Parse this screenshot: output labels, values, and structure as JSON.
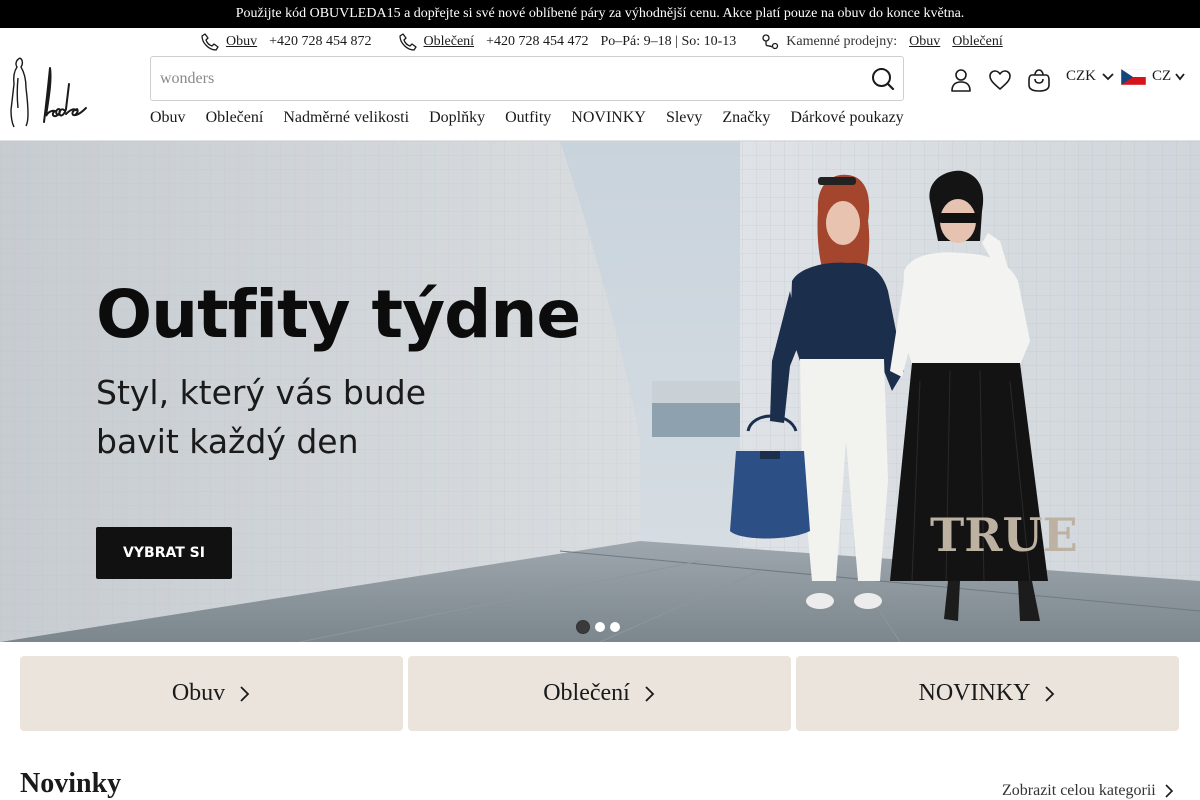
{
  "promo": {
    "text": "Použijte kód OBUVLEDA15 a dopřejte si své nové oblíbené páry za výhodnější cenu. Akce platí pouze na obuv do konce května."
  },
  "contact": {
    "shoes_link": "Obuv",
    "shoes_phone": "+420 728 454 872",
    "clothing_link": "Oblečení",
    "clothing_phone": "+420 728 454 472",
    "hours": "Po–Pá: 9–18 | So: 10-13",
    "stores_label": "Kamenné prodejny:",
    "stores_shoes": "Obuv",
    "stores_clothing": "Oblečení"
  },
  "search": {
    "placeholder": "wonders"
  },
  "header": {
    "currency": "CZK",
    "language": "CZ"
  },
  "nav": {
    "items": [
      "Obuv",
      "Oblečení",
      "Nadměrné velikosti",
      "Doplňky",
      "Outfity",
      "NOVINKY",
      "Slevy",
      "Značky",
      "Dárkové poukazy"
    ]
  },
  "hero": {
    "title": "Outfity týdne",
    "subtitle_line1": "Styl, který vás bude",
    "subtitle_line2": "bavit každý den",
    "button": "VYBRAT SI",
    "skirt_text": "TRUE",
    "active_slide": 1,
    "slide_count": 3
  },
  "categories": [
    {
      "label": "Obuv"
    },
    {
      "label": "Oblečení"
    },
    {
      "label": "NOVINKY"
    }
  ],
  "section": {
    "title": "Novinky",
    "see_all": "Zobrazit celou kategorii"
  },
  "colors": {
    "promo_bg": "#000000",
    "category_bg": "#eae4dc",
    "button_bg": "#111111"
  }
}
